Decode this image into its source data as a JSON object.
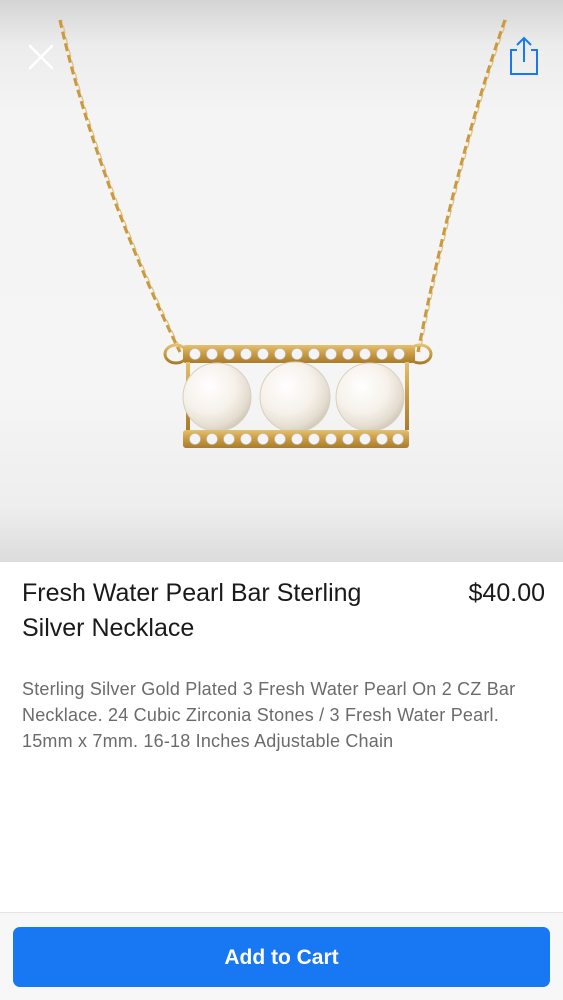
{
  "product": {
    "title": "Fresh Water Pearl Bar Sterling Silver Necklace",
    "price": "$40.00",
    "description": "Sterling Silver Gold Plated 3 Fresh Water Pearl On 2 CZ Bar Necklace. 24 Cubic Zirconia Stones / 3 Fresh Water Pearl. 15mm x 7mm. 16-18 Inches Adjustable Chain",
    "image_alt": "necklace-photo"
  },
  "actions": {
    "add_to_cart_label": "Add to Cart"
  },
  "icons": {
    "close": "close-icon",
    "share": "share-icon"
  },
  "colors": {
    "accent": "#1877f2",
    "gold": "#c9a24a",
    "text_primary": "#1a1a1a",
    "text_secondary": "#6b6b6b"
  }
}
